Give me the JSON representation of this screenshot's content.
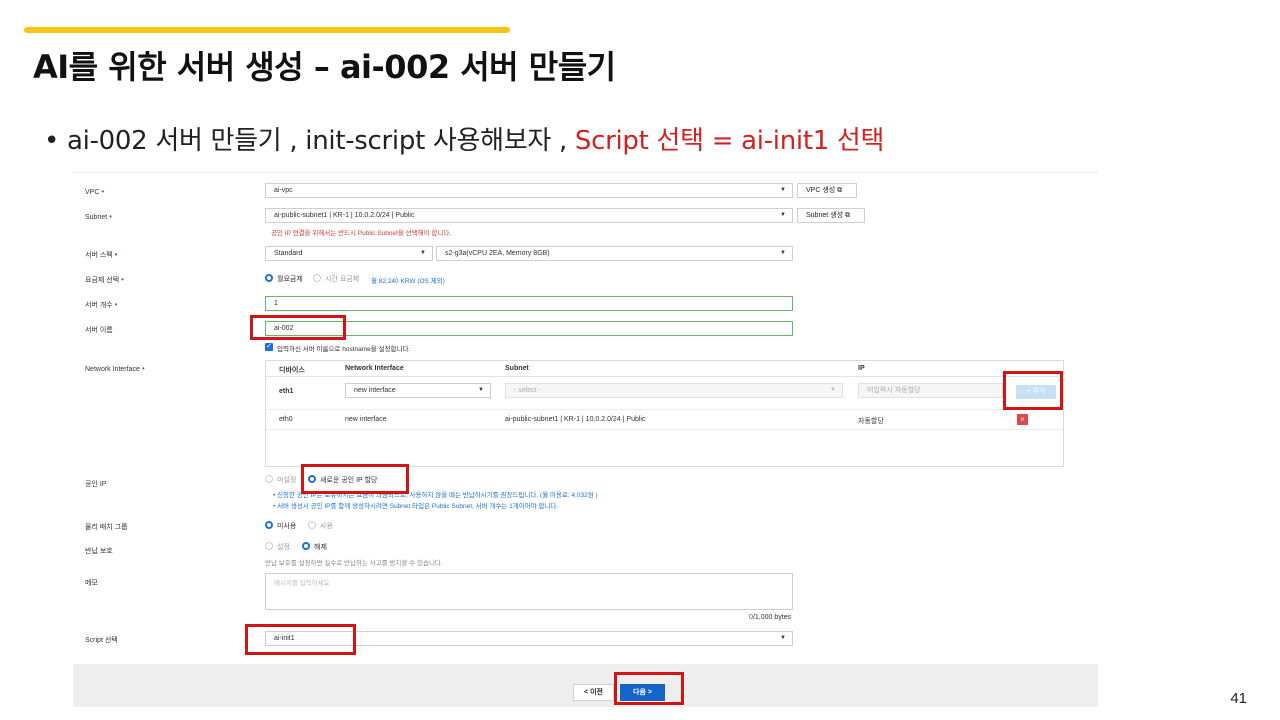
{
  "slide": {
    "title": "AI를 위한 서버 생성 – ai-002 서버 만들기",
    "bullet": {
      "marker": "•",
      "text": "ai-002 서버 만들기 , init-script 사용해보자 , ",
      "highlight": "Script 선택 = ai-init1 선택"
    },
    "page_number": "41",
    "colors": {
      "accent_bar": "#f5c518",
      "highlight_text": "#d42020",
      "annotation_box": "#d21414"
    }
  },
  "form": {
    "vpc": {
      "label": "VPC",
      "value": "ai-vpc",
      "button": "VPC 생성"
    },
    "subnet": {
      "label": "Subnet",
      "value": "ai-public-subnet1 | KR-1 | 10.0.2.0/24 | Public",
      "button": "Subnet 생성",
      "hint": "공인 IP 연결을 위해서는 반드시 Public Subnet을 선택해야 합니다."
    },
    "server_spec": {
      "label": "서버 스펙",
      "type": "Standard",
      "spec": "s2-g3a(vCPU 2EA, Memory 8GB)"
    },
    "billing": {
      "label": "요금제 선택",
      "options": [
        "월요금제",
        "시간 요금제"
      ],
      "selected": "월요금제",
      "price": "월 82,240 KRW (OS 제외)"
    },
    "server_count": {
      "label": "서버 개수",
      "value": "1"
    },
    "server_name": {
      "label": "서버 이름",
      "value": "ai-002",
      "checkbox_label": "입력하신 서버 이름으로 hostname을 설정합니다."
    },
    "network_interface": {
      "label": "Network Interface",
      "headers": [
        "디바이스",
        "Network Interface",
        "Subnet",
        "IP"
      ],
      "new_row": {
        "device": "eth1",
        "interface": "new interface",
        "subnet_placeholder": "- select -",
        "ip_placeholder": "미입력시 자동할당",
        "add_button": "+ 추가"
      },
      "rows": [
        {
          "device": "eth0",
          "interface": "new interface",
          "subnet": "ai-public-subnet1 | KR-1 | 10.0.2.0/24 | Public",
          "ip": "자동할당",
          "delete": "×"
        }
      ]
    },
    "public_ip": {
      "label": "공인 IP",
      "options": [
        "미설정",
        "새로운 공인 IP 할당"
      ],
      "selected": "새로운 공인 IP 할당",
      "notes": [
        "• 신청한 공인 IP는 보유하시는 요금이 과금되므로, 사용하지 않을 때는 반납하시기를 권장드립니다. (월 이용료: 4,032원 )",
        "• 서버 생성시 공인 IP를 함께 생성하시려면 Subnet 타입은 Public Subnet, 서버 개수는 1개이어야 합니다."
      ]
    },
    "placement_group": {
      "label": "물리 배치 그룹",
      "options": [
        "미사용",
        "사용"
      ],
      "selected": "미사용"
    },
    "return_protection": {
      "label": "반납 보호",
      "options": [
        "설정",
        "해제"
      ],
      "selected": "해제",
      "hint": "반납 보호를 설정하면 실수로 반납하는 사고를 방지할 수 있습니다."
    },
    "memo": {
      "label": "메모",
      "placeholder": "메시지를 입력하세요",
      "count": "0",
      "max": "/1,000 bytes"
    },
    "script": {
      "label": "Script 선택",
      "value": "ai-init1"
    }
  },
  "footer": {
    "prev_label": "< 이전",
    "next_label": "다음 >"
  }
}
